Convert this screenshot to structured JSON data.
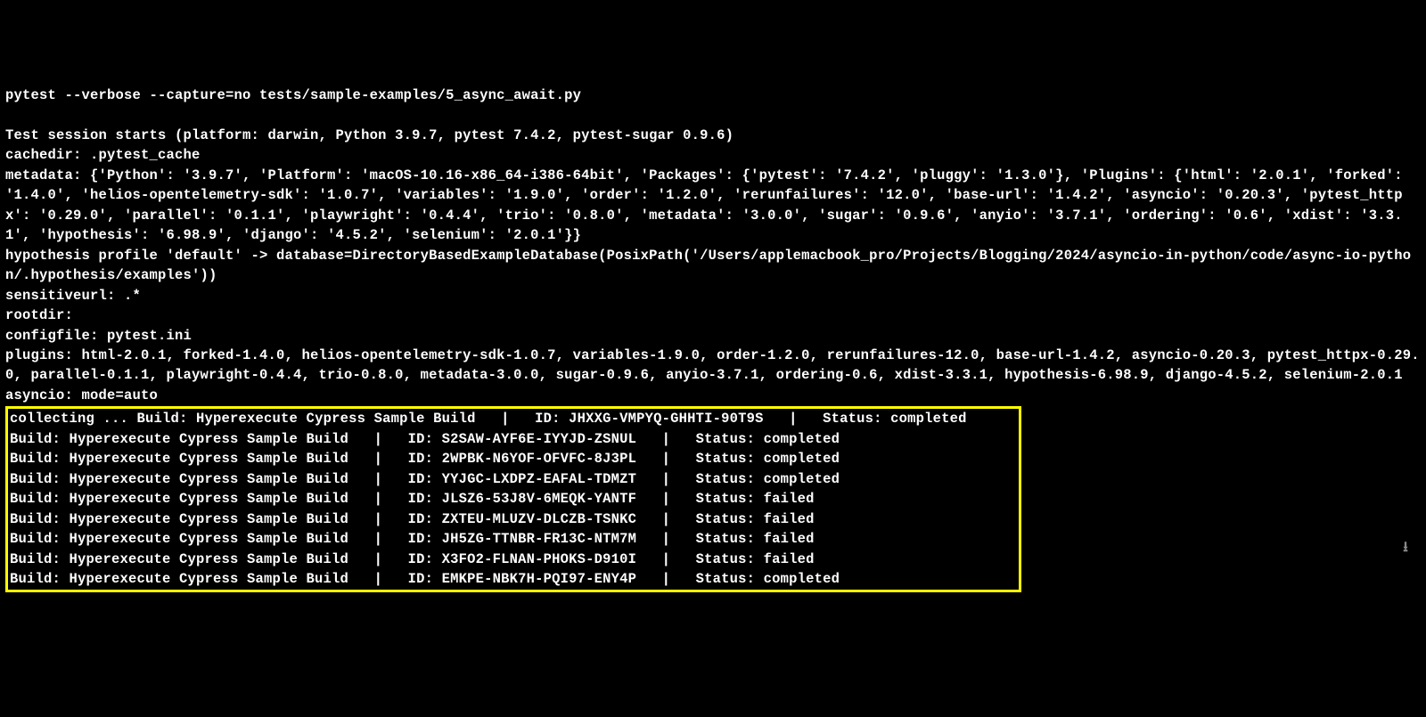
{
  "command": "pytest --verbose --capture=no tests/sample-examples/5_async_await.py",
  "session_header": "Test session starts (platform: darwin, Python 3.9.7, pytest 7.4.2, pytest-sugar 0.9.6)",
  "cachedir": "cachedir: .pytest_cache",
  "metadata": "metadata: {'Python': '3.9.7', 'Platform': 'macOS-10.16-x86_64-i386-64bit', 'Packages': {'pytest': '7.4.2', 'pluggy': '1.3.0'}, 'Plugins': {'html': '2.0.1', 'forked': '1.4.0', 'helios-opentelemetry-sdk': '1.0.7', 'variables': '1.9.0', 'order': '1.2.0', 'rerunfailures': '12.0', 'base-url': '1.4.2', 'asyncio': '0.20.3', 'pytest_httpx': '0.29.0', 'parallel': '0.1.1', 'playwright': '0.4.4', 'trio': '0.8.0', 'metadata': '3.0.0', 'sugar': '0.9.6', 'anyio': '3.7.1', 'ordering': '0.6', 'xdist': '3.3.1', 'hypothesis': '6.98.9', 'django': '4.5.2', 'selenium': '2.0.1'}}",
  "hypothesis": "hypothesis profile 'default' -> database=DirectoryBasedExampleDatabase(PosixPath('/Users/applemacbook_pro/Projects/Blogging/2024/asyncio-in-python/code/async-io-python/.hypothesis/examples'))",
  "sensitiveurl": "sensitiveurl: .*",
  "rootdir": "rootdir:",
  "configfile": "configfile: pytest.ini",
  "plugins": "plugins: html-2.0.1, forked-1.4.0, helios-opentelemetry-sdk-1.0.7, variables-1.9.0, order-1.2.0, rerunfailures-12.0, base-url-1.4.2, asyncio-0.20.3, pytest_httpx-0.29.0, parallel-0.1.1, playwright-0.4.4, trio-0.8.0, metadata-3.0.0, sugar-0.9.6, anyio-3.7.1, ordering-0.6, xdist-3.3.1, hypothesis-6.98.9, django-4.5.2, selenium-2.0.1",
  "asyncio": "asyncio: mode=auto",
  "collecting_prefix": "collecting ... ",
  "build_name": "Hyperexecute Cypress Sample Build",
  "first_row": "Build: Hyperexecute Cypress Sample Build   |   ID: JHXXG-VMPYQ-GHHTI-90T9S   |   Status: completed",
  "rows": [
    {
      "line": "Build: Hyperexecute Cypress Sample Build   |   ID: S2SAW-AYF6E-IYYJD-ZSNUL   |   Status: completed"
    },
    {
      "line": "Build: Hyperexecute Cypress Sample Build   |   ID: 2WPBK-N6YOF-OFVFC-8J3PL   |   Status: completed"
    },
    {
      "line": "Build: Hyperexecute Cypress Sample Build   |   ID: YYJGC-LXDPZ-EAFAL-TDMZT   |   Status: completed"
    },
    {
      "line": "Build: Hyperexecute Cypress Sample Build   |   ID: JLSZ6-53J8V-6MEQK-YANTF   |   Status: failed"
    },
    {
      "line": "Build: Hyperexecute Cypress Sample Build   |   ID: ZXTEU-MLUZV-DLCZB-TSNKC   |   Status: failed"
    },
    {
      "line": "Build: Hyperexecute Cypress Sample Build   |   ID: JH5ZG-TTNBR-FR13C-NTM7M   |   Status: failed"
    },
    {
      "line": "Build: Hyperexecute Cypress Sample Build   |   ID: X3FO2-FLNAN-PHOKS-D910I   |   Status: failed"
    },
    {
      "line": "Build: Hyperexecute Cypress Sample Build   |   ID: EMKPE-NBK7H-PQI97-ENY4P   |   Status: completed"
    }
  ],
  "scroll_icon": "⭳"
}
